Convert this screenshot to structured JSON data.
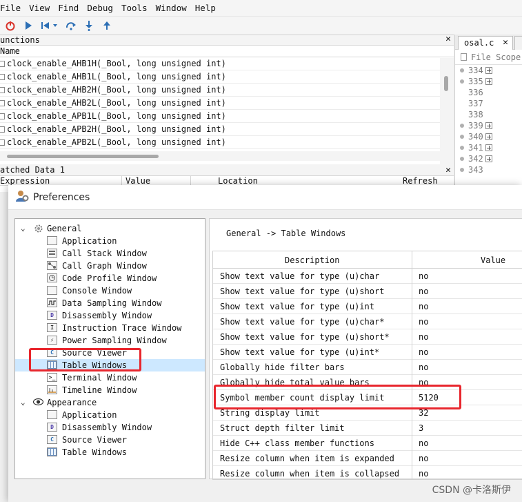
{
  "menu": [
    "File",
    "View",
    "Find",
    "Debug",
    "Tools",
    "Window",
    "Help"
  ],
  "functions_panel": {
    "title": "unctions",
    "column": "Name",
    "rows": [
      "clock_enable_AHB1H(_Bool, long unsigned int)",
      "clock_enable_AHB1L(_Bool, long unsigned int)",
      "clock_enable_AHB2H(_Bool, long unsigned int)",
      "clock_enable_AHB2L(_Bool, long unsigned int)",
      "clock_enable_APB1L(_Bool, long unsigned int)",
      "clock_enable_APB2H(_Bool, long unsigned int)",
      "clock_enable_APB2L(_Bool, long unsigned int)"
    ]
  },
  "watched_panel": {
    "title": "atched Data 1",
    "columns": [
      "Expression",
      "Value",
      "Location",
      "Refresh"
    ]
  },
  "editor": {
    "tab_label": "osal.c",
    "scope": "File Scope",
    "lines": [
      {
        "num": "334",
        "dot": true,
        "fold": true
      },
      {
        "num": "335",
        "dot": true,
        "fold": true
      },
      {
        "num": "336",
        "dot": false,
        "fold": false
      },
      {
        "num": "337",
        "dot": false,
        "fold": false
      },
      {
        "num": "338",
        "dot": false,
        "fold": false
      },
      {
        "num": "339",
        "dot": true,
        "fold": true
      },
      {
        "num": "340",
        "dot": true,
        "fold": true
      },
      {
        "num": "341",
        "dot": true,
        "fold": true
      },
      {
        "num": "342",
        "dot": true,
        "fold": true
      },
      {
        "num": "343",
        "dot": true,
        "fold": false
      }
    ]
  },
  "dialog": {
    "title": "Preferences",
    "breadcrumb": "General -> Table Windows",
    "tree": [
      {
        "label": "General",
        "level": 0,
        "icon": "gear-icon",
        "expanded": true
      },
      {
        "label": "Application",
        "level": 1,
        "icon": "window-icon"
      },
      {
        "label": "Call Stack Window",
        "level": 1,
        "icon": "call-stack-icon"
      },
      {
        "label": "Call Graph Window",
        "level": 1,
        "icon": "call-graph-icon"
      },
      {
        "label": "Code Profile Window",
        "level": 1,
        "icon": "profile-icon"
      },
      {
        "label": "Console Window",
        "level": 1,
        "icon": "window-icon"
      },
      {
        "label": "Data Sampling Window",
        "level": 1,
        "icon": "waveform-icon"
      },
      {
        "label": "Disassembly Window",
        "level": 1,
        "icon": "disassembly-icon",
        "glyph": "D"
      },
      {
        "label": "Instruction Trace Window",
        "level": 1,
        "icon": "instruction-trace-icon",
        "glyph": "I"
      },
      {
        "label": "Power Sampling Window",
        "level": 1,
        "icon": "power-icon",
        "glyph": "⚡"
      },
      {
        "label": "Source Viewer",
        "level": 1,
        "icon": "source-icon",
        "glyph": "C"
      },
      {
        "label": "Table Windows",
        "level": 1,
        "icon": "table-icon",
        "selected": true
      },
      {
        "label": "Terminal Window",
        "level": 1,
        "icon": "terminal-icon",
        "glyph": ">_"
      },
      {
        "label": "Timeline Window",
        "level": 1,
        "icon": "timeline-icon"
      },
      {
        "label": "Appearance",
        "level": 0,
        "icon": "eye-icon",
        "expanded": true
      },
      {
        "label": "Application",
        "level": 1,
        "icon": "window-icon"
      },
      {
        "label": "Disassembly Window",
        "level": 1,
        "icon": "disassembly-icon",
        "glyph": "D"
      },
      {
        "label": "Source Viewer",
        "level": 1,
        "icon": "source-icon",
        "glyph": "C"
      },
      {
        "label": "Table Windows",
        "level": 1,
        "icon": "table-icon"
      }
    ],
    "table": {
      "columns": [
        "Description",
        "Value"
      ],
      "rows": [
        {
          "desc": "Show text value for type (u)char",
          "value": "no"
        },
        {
          "desc": "Show text value for type (u)short",
          "value": "no"
        },
        {
          "desc": "Show text value for type (u)int",
          "value": "no"
        },
        {
          "desc": "Show text value for type (u)char*",
          "value": "no"
        },
        {
          "desc": "Show text value for type (u)short*",
          "value": "no"
        },
        {
          "desc": "Show text value for type (u)int*",
          "value": "no"
        },
        {
          "desc": "Globally hide filter bars",
          "value": "no"
        },
        {
          "desc": "Globally hide total value bars",
          "value": "no"
        },
        {
          "desc": "Symbol member count display limit",
          "value": "5120"
        },
        {
          "desc": "String display limit",
          "value": "32"
        },
        {
          "desc": "Struct depth filter limit",
          "value": "3"
        },
        {
          "desc": "Hide C++ class member functions",
          "value": "no"
        },
        {
          "desc": "Resize column when item is expanded",
          "value": "no"
        },
        {
          "desc": "Resize column when item is collapsed",
          "value": "no"
        }
      ]
    }
  },
  "watermark": "CSDN @卡洛斯伊",
  "colors": {
    "highlight": "#e8262d",
    "selection": "#cde8ff"
  }
}
